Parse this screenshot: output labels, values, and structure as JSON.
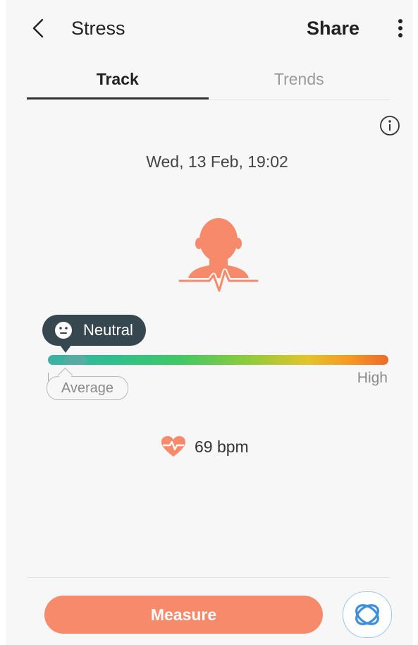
{
  "header": {
    "title": "Stress",
    "share_label": "Share"
  },
  "tabs": [
    {
      "label": "Track",
      "active": true
    },
    {
      "label": "Trends",
      "active": false
    }
  ],
  "measurement": {
    "timestamp": "Wed, 13 Feb, 19:02",
    "stress_level": "Neutral",
    "average_label": "Average",
    "high_label": "High",
    "stress_level_fraction": 0.05,
    "heart_rate": "69 bpm"
  },
  "actions": {
    "measure_label": "Measure"
  },
  "colors": {
    "accent": "#f78a6a",
    "tooltip_bg": "#37474f",
    "gauge_low": "#3fb0a4",
    "gauge_high": "#ee6a2a"
  },
  "icons": {
    "back": "chevron-left-icon",
    "more": "more-vertical-icon",
    "info": "info-icon",
    "figure": "person-heartbeat-icon",
    "face": "neutral-face-icon",
    "heart": "heart-pulse-icon",
    "bixby": "bixby-icon"
  }
}
